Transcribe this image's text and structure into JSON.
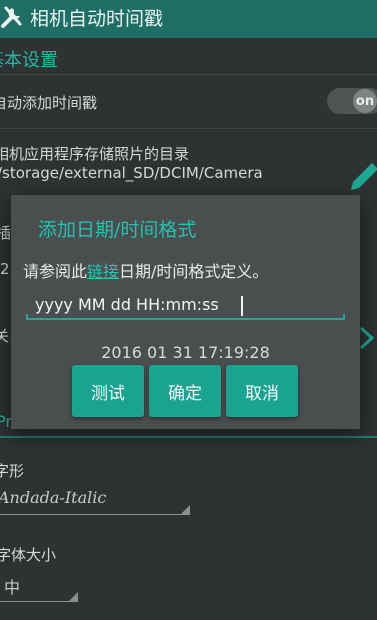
{
  "app": {
    "title": "相机自动时间戳"
  },
  "basic": {
    "header": "基本设置",
    "auto_add_label": "自动添加时间戳",
    "toggle_text": "on",
    "dir_label": "相机应用程序存储照片的目录",
    "dir_value": "/storage/external_SD/DCIM/Camera",
    "peek_1": "插",
    "peek_2": "2",
    "peek_3": "关",
    "peek_4": "Pre"
  },
  "font": {
    "label": "字形",
    "value": "Andada-Italic",
    "size_label": "字体大小",
    "size_value": "中"
  },
  "dialog": {
    "title": "添加日期/时间格式",
    "message_prefix": "请参阅此",
    "message_link": "链接",
    "message_suffix": "日期/时间格式定义。",
    "input_value": "yyyy MM dd HH:mm:ss",
    "preview": "2016 01 31 17:19:28",
    "buttons": {
      "test": "测试",
      "ok": "确定",
      "cancel": "取消"
    }
  },
  "colors": {
    "accent": "#23b8a6",
    "appbar": "#1f6e66",
    "button": "#1aa391",
    "background": "#2f3232",
    "dialog": "#4a4e4e"
  }
}
